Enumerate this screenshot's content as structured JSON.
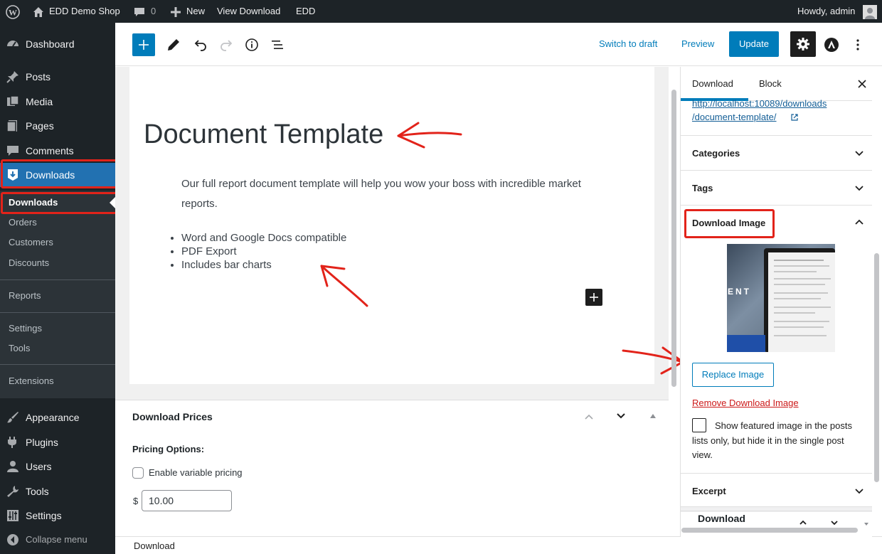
{
  "admin_bar": {
    "site_name": "EDD Demo Shop",
    "comments_count": "0",
    "new_label": "New",
    "view_label": "View Download",
    "edd_label": "EDD",
    "howdy": "Howdy, admin"
  },
  "admin_menu": {
    "items": [
      {
        "label": "Dashboard",
        "icon": "dashboard-icon"
      },
      {
        "label": "Posts",
        "icon": "pin-icon"
      },
      {
        "label": "Media",
        "icon": "media-icon"
      },
      {
        "label": "Pages",
        "icon": "pages-icon"
      },
      {
        "label": "Comments",
        "icon": "comment-icon"
      },
      {
        "label": "Downloads",
        "icon": "download-icon"
      }
    ],
    "submenu": [
      "Downloads",
      "Orders",
      "Customers",
      "Discounts",
      "Reports",
      "Settings",
      "Tools",
      "Extensions"
    ],
    "lower_items": [
      {
        "label": "Appearance",
        "icon": "brush-icon"
      },
      {
        "label": "Plugins",
        "icon": "plugin-icon"
      },
      {
        "label": "Users",
        "icon": "user-icon"
      },
      {
        "label": "Tools",
        "icon": "wrench-icon"
      },
      {
        "label": "Settings",
        "icon": "settings-icon"
      }
    ],
    "collapse_label": "Collapse menu",
    "active_color": "#2271b1"
  },
  "toolbar": {
    "switch_to_draft": "Switch to draft",
    "preview": "Preview",
    "update": "Update"
  },
  "post": {
    "title": "Document Template",
    "paragraph": "Our full report document template will help you wow your boss with incredible market reports.",
    "bullets": [
      "Word and Google Docs compatible",
      "PDF Export",
      "Includes bar charts"
    ]
  },
  "meta_box": {
    "title": "Download Prices",
    "pricing_options_label": "Pricing Options:",
    "variable_pricing_label": "Enable variable pricing",
    "currency": "$",
    "price": "10.00"
  },
  "footer": {
    "breadcrumb": "Download"
  },
  "sidebar": {
    "tabs": [
      "Download",
      "Block"
    ],
    "permalink_line1": "http://localhost:10089/downloads",
    "permalink_line2": "/document-template/",
    "panels": {
      "categories": "Categories",
      "tags": "Tags",
      "download_image": "Download Image",
      "excerpt": "Excerpt",
      "download": "Download"
    },
    "replace_image": "Replace Image",
    "remove_image": "Remove Download Image",
    "featured_only_label": "Show featured image in the posts lists only, but hide it in the single post view.",
    "thumb_text": "ENT"
  },
  "colors": {
    "accent": "#007cba",
    "highlight": "#e2231a",
    "admin_dark": "#1d2327"
  }
}
